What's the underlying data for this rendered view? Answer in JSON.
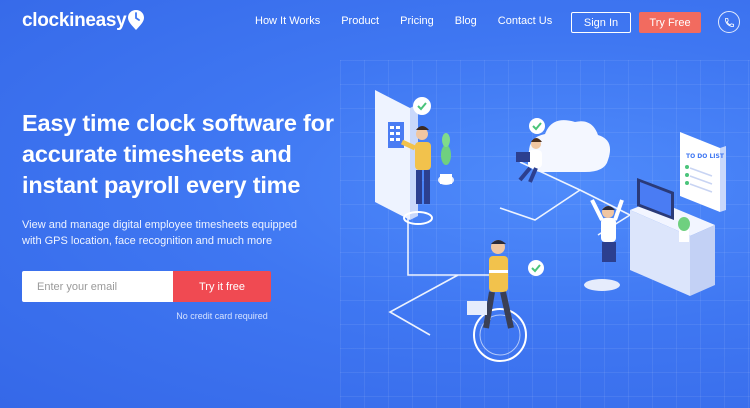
{
  "brand": {
    "name": "clockineasy"
  },
  "nav": {
    "links": [
      "How It Works",
      "Product",
      "Pricing",
      "Blog",
      "Contact Us"
    ],
    "sign_in": "Sign In",
    "try_free": "Try Free"
  },
  "hero": {
    "headline_lines": [
      "Easy time clock software for",
      "accurate timesheets and",
      "instant payroll every time"
    ],
    "subtext_lines": [
      "View and manage digital employee timesheets equipped",
      "with GPS location, face recognition and much more"
    ],
    "email_placeholder": "Enter your email",
    "cta": "Try it free",
    "note": "No credit card required"
  },
  "illustration": {
    "todo_title": "TO DO LIST"
  },
  "colors": {
    "background": "#3f77f2",
    "accent_try_free": "#f26b5f",
    "accent_cta": "#f04a52"
  },
  "icons": [
    "logo-pin-icon",
    "phone-icon",
    "check-icon"
  ]
}
